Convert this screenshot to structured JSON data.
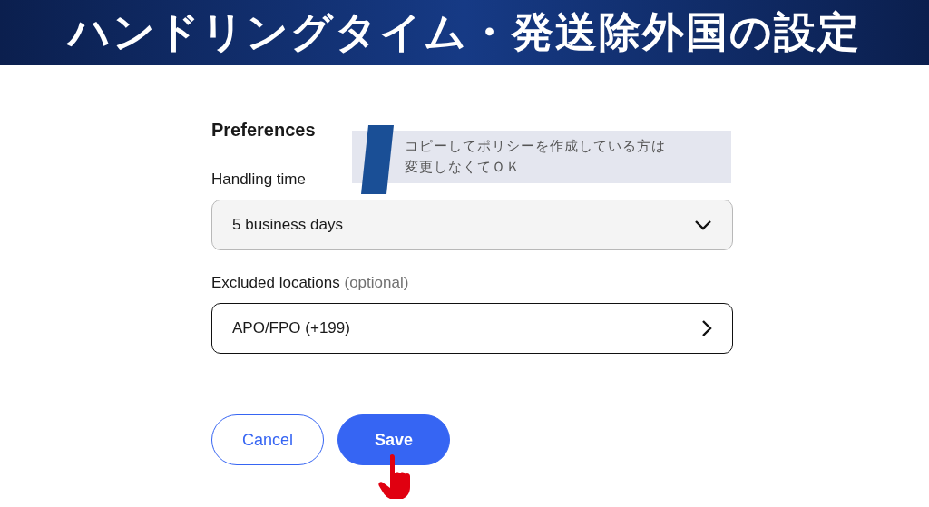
{
  "banner": {
    "title": "ハンドリングタイム・発送除外国の設定"
  },
  "form": {
    "heading": "Preferences",
    "handling_time": {
      "label": "Handling time",
      "value": "5 business days"
    },
    "excluded_locations": {
      "label": "Excluded locations",
      "hint": "(optional)",
      "value": "APO/FPO (+199)"
    },
    "buttons": [
      {
        "label": "Cancel",
        "kind": "secondary"
      },
      {
        "label": "Save",
        "kind": "primary"
      }
    ]
  },
  "note": {
    "lines": [
      "コピーしてポリシーを作成している方は",
      "変更しなくてＯＫ"
    ]
  }
}
